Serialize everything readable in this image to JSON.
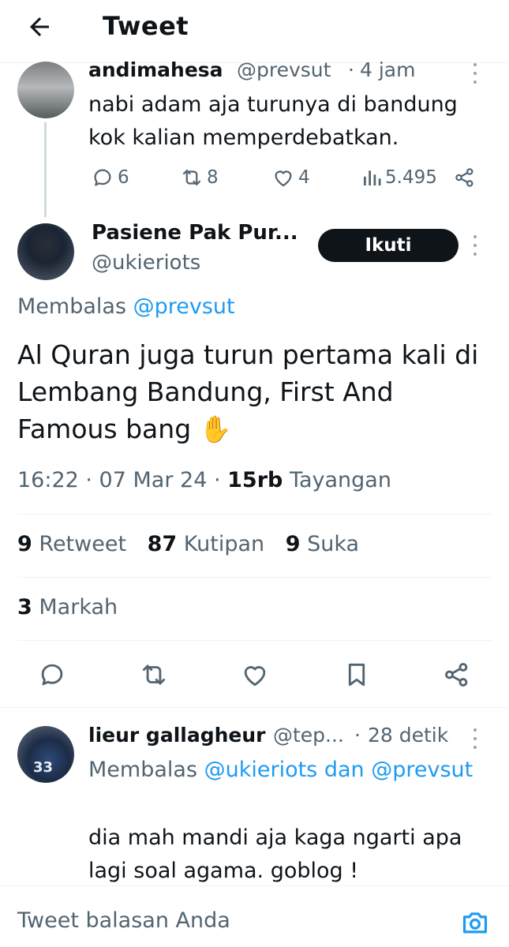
{
  "header": {
    "title": "Tweet",
    "back_icon": "arrow-left-icon"
  },
  "parent_tweet": {
    "name": "andimahesa",
    "handle": "@prevsut",
    "dot": "·",
    "time": "4 jam",
    "text": "nabi adam aja turunya di bandung kok kalian memperdebatkan.",
    "stats": {
      "replies": "6",
      "retweets": "8",
      "likes": "4",
      "views": "5.495"
    }
  },
  "main_tweet": {
    "name": "Pasiene Pak Pur...",
    "handle": "@ukieriots",
    "follow_label": "Ikuti",
    "replying_prefix": "Membalas",
    "replying_to": "@prevsut",
    "text": "Al Quran juga turun pertama kali di Lembang Bandung, First And Famous bang ✋",
    "time": "16:22 · 07 Mar 24 ·",
    "views_count": "15rb",
    "views_label": "Tayangan",
    "counts": {
      "retweets": "9",
      "retweets_label": "Retweet",
      "quotes": "87",
      "quotes_label": "Kutipan",
      "likes": "9",
      "likes_label": "Suka",
      "bookmarks": "3",
      "bookmarks_label": "Markah"
    }
  },
  "reply_tweet": {
    "name": "lieur gallagheur",
    "handle": "@tep...",
    "dot": "·",
    "time": "28 detik",
    "replying_prefix": "Membalas",
    "replying_to": "@ukieriots dan @prevsut",
    "text": "dia mah mandi aja kaga ngarti apa lagi soal agama. goblog !",
    "avatar_text": "33"
  },
  "composer": {
    "placeholder": "Tweet balasan Anda"
  },
  "colors": {
    "accent": "#1d9bf0",
    "text": "#0f1419",
    "muted": "#536471",
    "button": "#0f1419"
  }
}
